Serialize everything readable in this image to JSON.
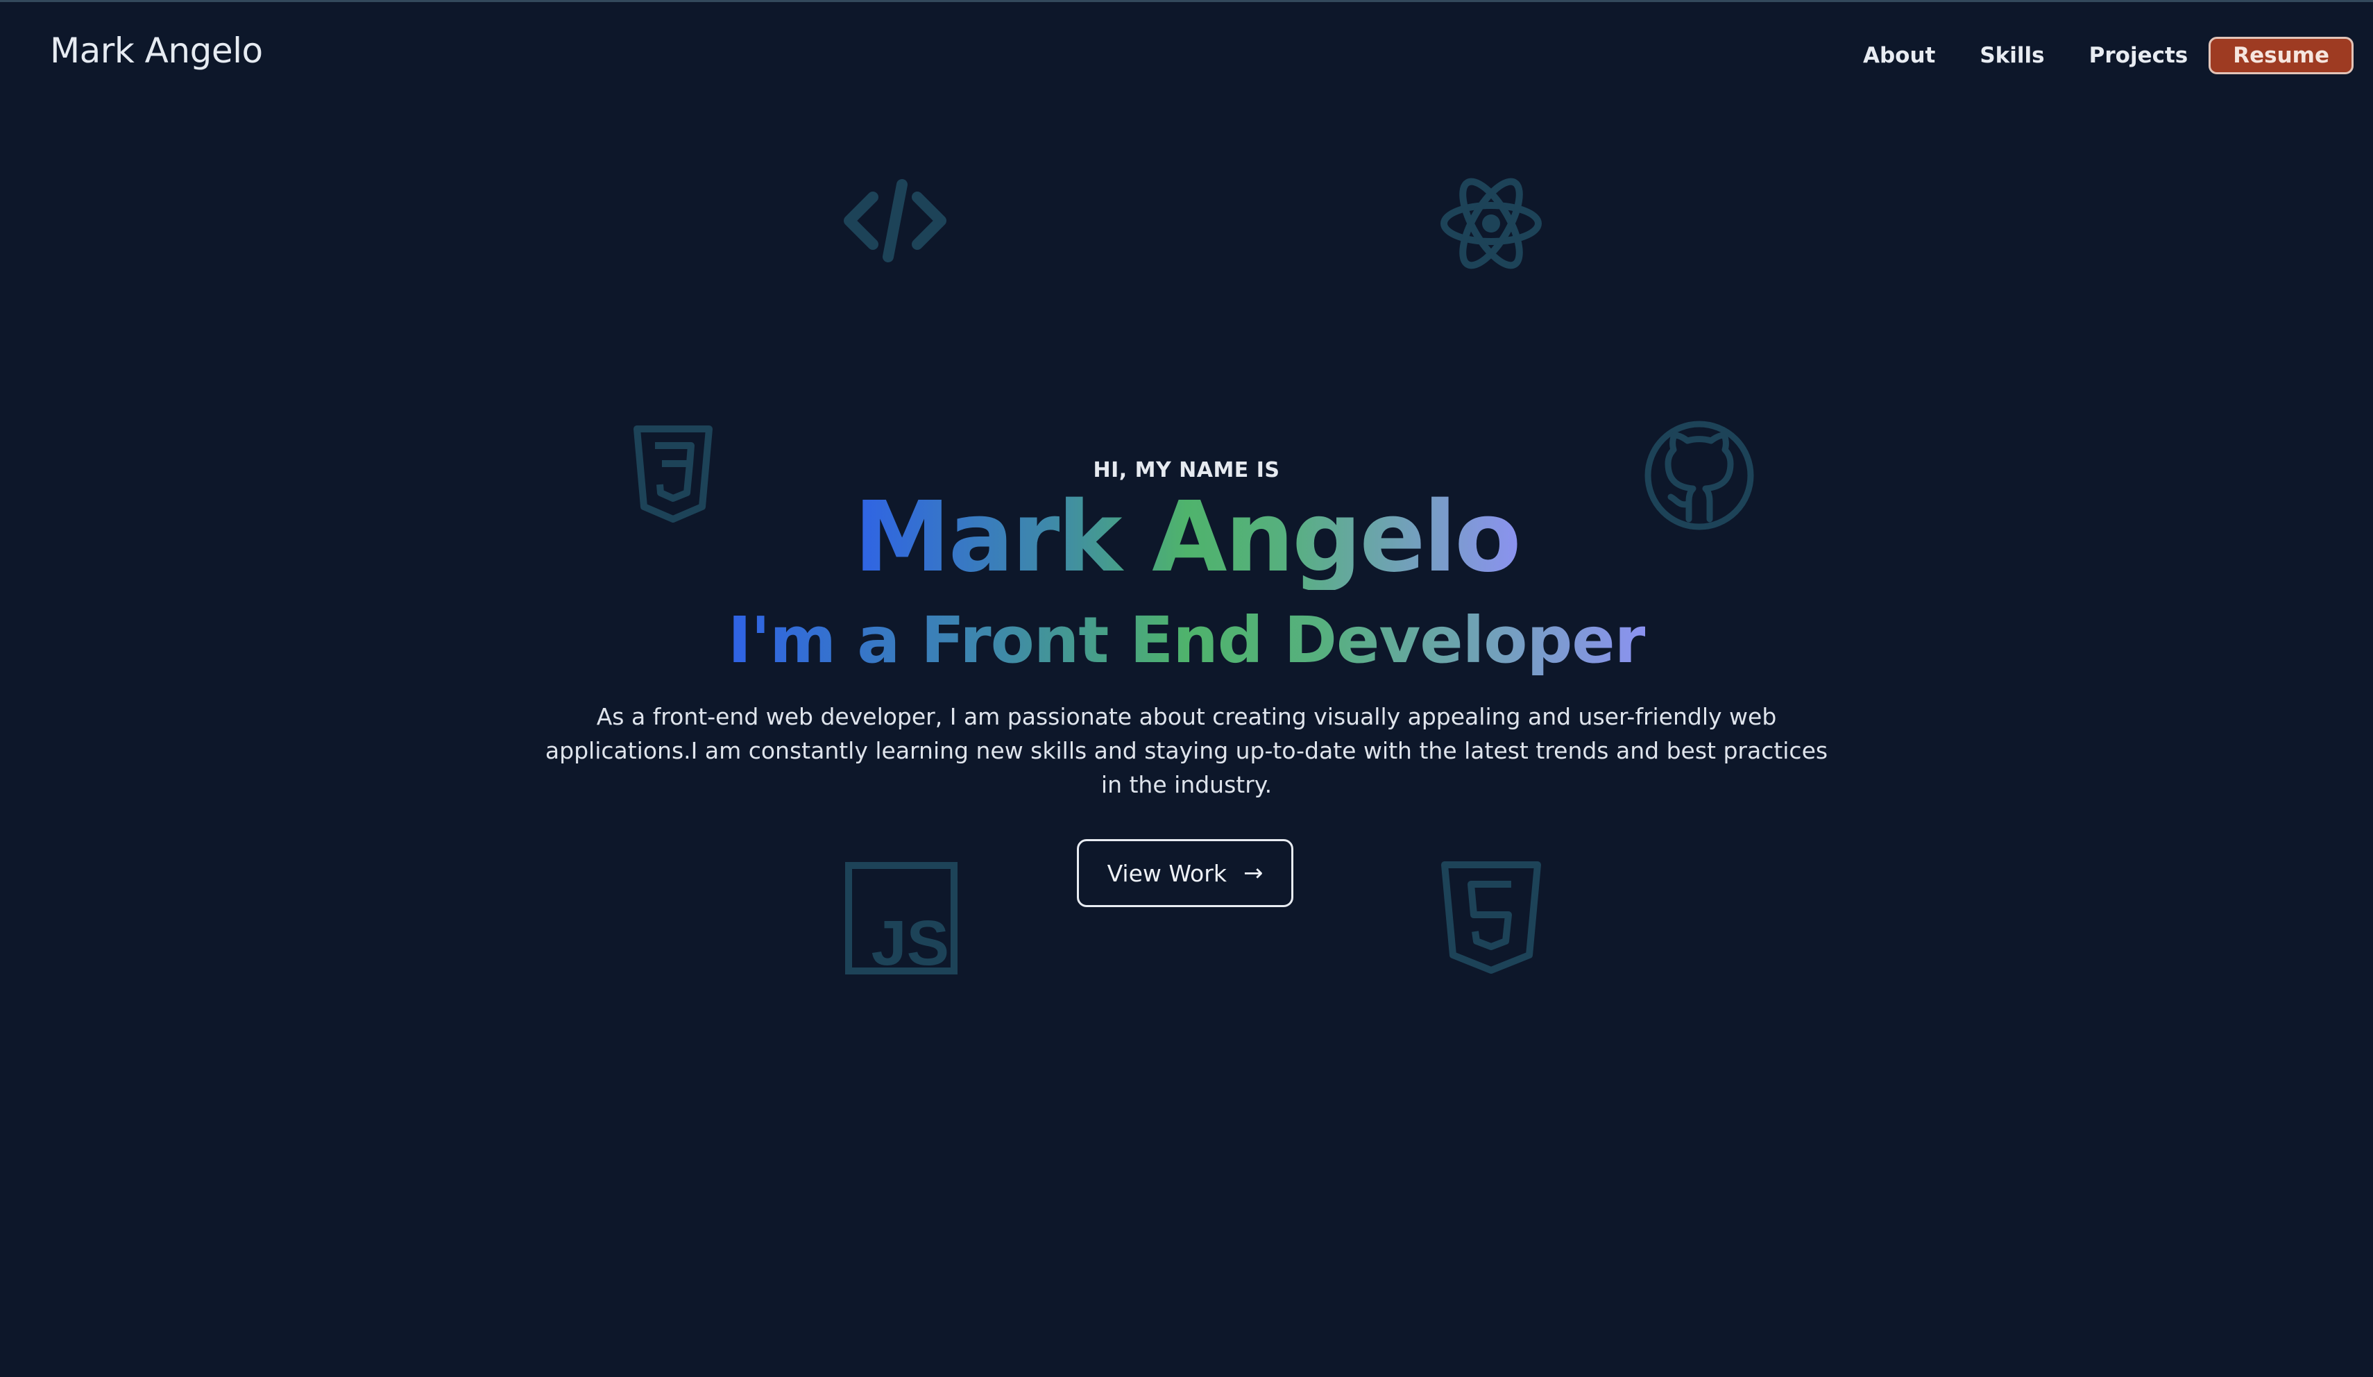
{
  "header": {
    "brand": "Mark Angelo",
    "nav": [
      {
        "label": "About"
      },
      {
        "label": "Skills"
      },
      {
        "label": "Projects"
      }
    ],
    "resume_label": "Resume"
  },
  "hero": {
    "greeting": "HI, MY NAME IS",
    "name": "Mark Angelo",
    "role": "I'm a Front End Developer",
    "bio": "As a front-end web developer, I am passionate about creating visually appealing and user-friendly web applications.I am constantly learning new skills and staying up-to-date with the latest trends and best practices in the industry.",
    "cta_label": "View Work",
    "cta_arrow": "→"
  },
  "decorative_icons": [
    "code-icon",
    "react-icon",
    "css3-icon",
    "github-icon",
    "javascript-icon",
    "html5-icon"
  ],
  "colors": {
    "background": "#0d172a",
    "accent_resume": "#9e3b22",
    "icon_color": "#1d4358",
    "gradient": [
      "#2f63e6",
      "#3f8aa8",
      "#4fb36c",
      "#8b92f0"
    ]
  }
}
